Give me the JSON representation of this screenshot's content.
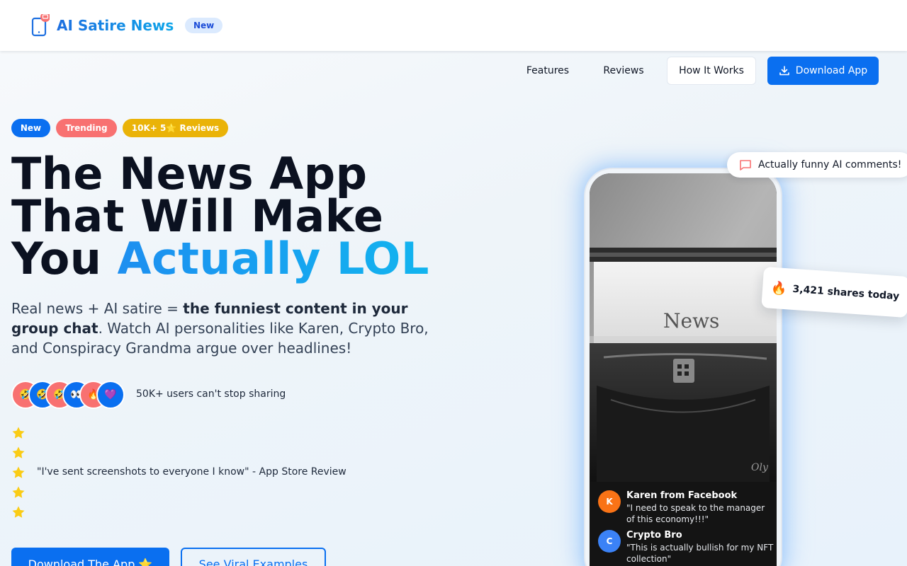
{
  "header": {
    "brand": "AI Satire News",
    "badge": "New"
  },
  "nav": {
    "features": "Features",
    "reviews": "Reviews",
    "how_it_works": "How It Works",
    "download": "Download App"
  },
  "hero": {
    "tags": [
      "New",
      "Trending",
      "10K+ 5⭐ Reviews"
    ],
    "headline_line1": "The News App",
    "headline_line2": "That Will Make",
    "headline_line3_plain": "You ",
    "headline_line3_accent": "Actually LOL",
    "sub_plain_1": "Real news + AI satire = ",
    "sub_bold": "the funniest content in your group chat",
    "sub_plain_2": ". Watch AI personalities like Karen, Crypto Bro, and Conspiracy Grandma argue over headlines!",
    "avatar_emojis": [
      "🤣",
      "🤣",
      "🤣",
      "👀",
      "🔥",
      "💜"
    ],
    "users_text": "50K+ users can't stop sharing",
    "rating": 5,
    "review_quote": "\"I've sent screenshots to everyone I know\" - App Store Review",
    "cta_primary": "Download The App ⭐",
    "cta_secondary": "See Viral Examples"
  },
  "phone": {
    "photo_text": "News",
    "comments": [
      {
        "initial": "K",
        "name": "Karen from Facebook",
        "text": "\"I need to speak to the manager of this economy!!!\""
      },
      {
        "initial": "C",
        "name": "Crypto Bro",
        "text": "\"This is actually bullish for my NFT collection\""
      }
    ]
  },
  "floating": {
    "funny": "Actually funny AI comments!",
    "shares_icon": "🔥",
    "shares": "3,421 shares today"
  },
  "colors": {
    "primary": "#0a6ff0",
    "accent_gradient_start": "#1d8ff0",
    "accent_gradient_end": "#12b4ef",
    "trending": "#f87171",
    "reviews_badge": "#eab308",
    "star": "#facc15"
  },
  "icons": {
    "brand": "phone-icon",
    "download": "download-icon",
    "chat": "message-square-icon",
    "star": "star-icon"
  }
}
